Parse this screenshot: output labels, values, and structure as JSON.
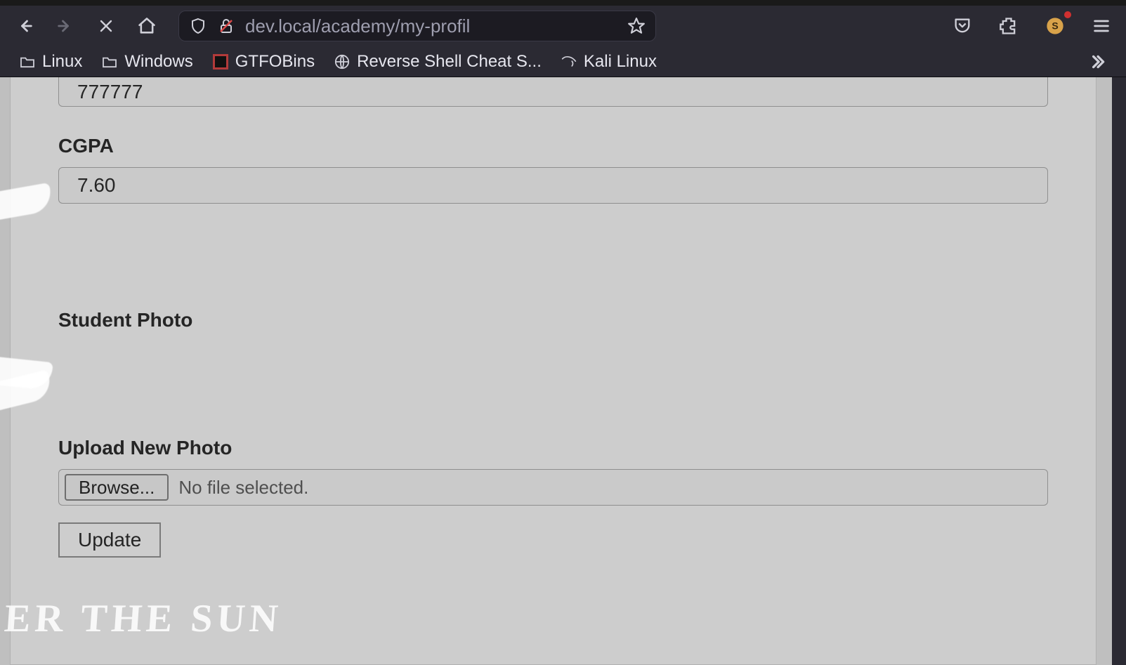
{
  "url": "dev.local/academy/my-profil",
  "bookmarks": [
    {
      "label": "Linux",
      "kind": "folder"
    },
    {
      "label": "Windows",
      "kind": "folder"
    },
    {
      "label": "GTFOBins",
      "kind": "gtfo"
    },
    {
      "label": "Reverse Shell Cheat S...",
      "kind": "globe"
    },
    {
      "label": "Kali Linux",
      "kind": "kali"
    }
  ],
  "form": {
    "field_prev_value": "777777",
    "cgpa_label": "CGPA",
    "cgpa_value": "7.60",
    "student_photo_label": "Student Photo",
    "upload_label": "Upload New Photo",
    "browse_label": "Browse...",
    "file_status": "No file selected.",
    "update_label": "Update"
  },
  "watermark": "DER THE SUN"
}
